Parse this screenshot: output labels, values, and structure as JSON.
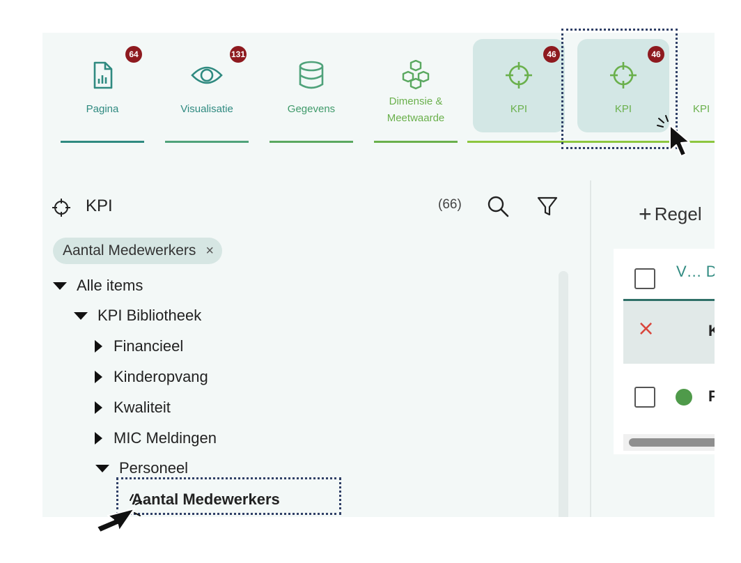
{
  "tabs": [
    {
      "label": "Pagina",
      "badge": "64",
      "icon": "page-chart-icon",
      "active": false
    },
    {
      "label": "Visualisatie",
      "badge": "131",
      "icon": "eye-icon",
      "active": false
    },
    {
      "label": "Gegevens",
      "badge": "",
      "icon": "database-icon",
      "active": false
    },
    {
      "label_line1": "Dimensie &",
      "label_line2": "Meetwaarde",
      "badge": "",
      "icon": "cubes-icon",
      "active": false
    },
    {
      "label": "KPI",
      "badge": "46",
      "icon": "crosshair-icon",
      "active": true
    },
    {
      "label": "KPI",
      "badge": "46",
      "icon": "crosshair-icon",
      "active": true
    },
    {
      "label": "KPI",
      "badge": "",
      "icon": "crosshair-icon",
      "active": false
    }
  ],
  "sidebar": {
    "title": "KPI",
    "count": "(66)",
    "filter_chip": "Aantal Medewerkers",
    "chip_close": "×",
    "tree": {
      "root": "Alle items",
      "library": "KPI Bibliotheek",
      "categories": [
        "Financieel",
        "Kinderopvang",
        "Kwaliteit",
        "MIC Meldingen"
      ],
      "expanded_category": "Personeel",
      "selected_item": "Aantal Medewerkers"
    }
  },
  "main": {
    "add_rule": "Regel",
    "add_symbol": "+",
    "column_header": "V… D",
    "selected_row_text": "K",
    "row_text": "P",
    "remove_symbol": "×"
  },
  "colors": {
    "teal": "#2f8a80",
    "green": "#6ab04c",
    "badge": "#8e1a1f",
    "active_tab": "#d3e7e5"
  }
}
